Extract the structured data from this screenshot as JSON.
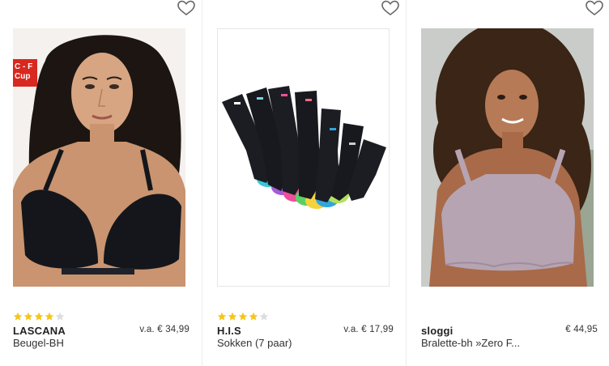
{
  "products": [
    {
      "brand": "LASCANA",
      "name": "Beugel-BH",
      "price": "v.a. € 34,99",
      "rating": 4,
      "max_rating": 5,
      "badge_line1": "C - F",
      "badge_line2": "Cup",
      "badge_color": "#d9281f"
    },
    {
      "brand": "H.I.S",
      "name": "Sokken (7 paar)",
      "price": "v.a. € 17,99",
      "rating": 4,
      "max_rating": 5
    },
    {
      "brand": "sloggi",
      "name": "Bralette-bh »Zero F...",
      "price": "€ 44,95"
    }
  ],
  "colors": {
    "star_filled": "#f6c51b",
    "star_empty": "#dddddd",
    "heart_outline": "#666666"
  },
  "icons": {
    "wishlist": "heart-outline-icon",
    "rating": "star-icon"
  }
}
